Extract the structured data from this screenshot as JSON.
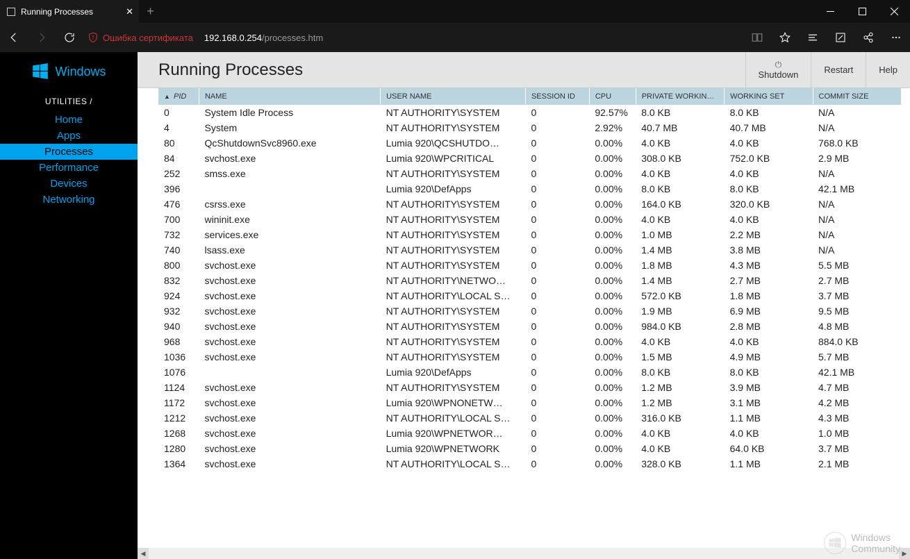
{
  "browser": {
    "tab_title": "Running Processes",
    "cert_error": "Ошибка сертификата",
    "url_host": "192.168.0.254",
    "url_path": "/processes.htm"
  },
  "sidebar": {
    "brand": "Windows",
    "section": "UTILITIES /",
    "items": [
      "Home",
      "Apps",
      "Processes",
      "Performance",
      "Devices",
      "Networking"
    ],
    "active_index": 2
  },
  "header": {
    "title": "Running Processes",
    "btn_shutdown": "Shutdown",
    "btn_restart": "Restart",
    "btn_help": "Help"
  },
  "table": {
    "columns": [
      "PID",
      "NAME",
      "USER NAME",
      "SESSION ID",
      "CPU",
      "PRIVATE WORKIN…",
      "WORKING SET",
      "COMMIT SIZE"
    ],
    "rows": [
      {
        "pid": "0",
        "name": "System Idle Process",
        "user": "NT AUTHORITY\\SYSTEM",
        "sess": "0",
        "cpu": "92.57%",
        "priv": "8.0 KB",
        "ws": "8.0 KB",
        "commit": "N/A"
      },
      {
        "pid": "4",
        "name": "System",
        "user": "NT AUTHORITY\\SYSTEM",
        "sess": "0",
        "cpu": "2.92%",
        "priv": "40.7 MB",
        "ws": "40.7 MB",
        "commit": "N/A"
      },
      {
        "pid": "80",
        "name": "QcShutdownSvc8960.exe",
        "user": "Lumia 920\\QCSHUTDO…",
        "sess": "0",
        "cpu": "0.00%",
        "priv": "4.0 KB",
        "ws": "4.0 KB",
        "commit": "768.0 KB"
      },
      {
        "pid": "84",
        "name": "svchost.exe",
        "user": "Lumia 920\\WPCRITICAL",
        "sess": "0",
        "cpu": "0.00%",
        "priv": "308.0 KB",
        "ws": "752.0 KB",
        "commit": "2.9 MB"
      },
      {
        "pid": "252",
        "name": "smss.exe",
        "user": "NT AUTHORITY\\SYSTEM",
        "sess": "0",
        "cpu": "0.00%",
        "priv": "4.0 KB",
        "ws": "4.0 KB",
        "commit": "N/A"
      },
      {
        "pid": "396",
        "name": "",
        "user": "Lumia 920\\DefApps",
        "sess": "0",
        "cpu": "0.00%",
        "priv": "8.0 KB",
        "ws": "8.0 KB",
        "commit": "42.1 MB"
      },
      {
        "pid": "476",
        "name": "csrss.exe",
        "user": "NT AUTHORITY\\SYSTEM",
        "sess": "0",
        "cpu": "0.00%",
        "priv": "164.0 KB",
        "ws": "320.0 KB",
        "commit": "N/A"
      },
      {
        "pid": "700",
        "name": "wininit.exe",
        "user": "NT AUTHORITY\\SYSTEM",
        "sess": "0",
        "cpu": "0.00%",
        "priv": "4.0 KB",
        "ws": "4.0 KB",
        "commit": "N/A"
      },
      {
        "pid": "732",
        "name": "services.exe",
        "user": "NT AUTHORITY\\SYSTEM",
        "sess": "0",
        "cpu": "0.00%",
        "priv": "1.0 MB",
        "ws": "2.2 MB",
        "commit": "N/A"
      },
      {
        "pid": "740",
        "name": "lsass.exe",
        "user": "NT AUTHORITY\\SYSTEM",
        "sess": "0",
        "cpu": "0.00%",
        "priv": "1.4 MB",
        "ws": "3.8 MB",
        "commit": "N/A"
      },
      {
        "pid": "800",
        "name": "svchost.exe",
        "user": "NT AUTHORITY\\SYSTEM",
        "sess": "0",
        "cpu": "0.00%",
        "priv": "1.8 MB",
        "ws": "4.3 MB",
        "commit": "5.5 MB"
      },
      {
        "pid": "832",
        "name": "svchost.exe",
        "user": "NT AUTHORITY\\NETWO…",
        "sess": "0",
        "cpu": "0.00%",
        "priv": "1.4 MB",
        "ws": "2.7 MB",
        "commit": "2.7 MB"
      },
      {
        "pid": "924",
        "name": "svchost.exe",
        "user": "NT AUTHORITY\\LOCAL S…",
        "sess": "0",
        "cpu": "0.00%",
        "priv": "572.0 KB",
        "ws": "1.8 MB",
        "commit": "3.7 MB"
      },
      {
        "pid": "932",
        "name": "svchost.exe",
        "user": "NT AUTHORITY\\SYSTEM",
        "sess": "0",
        "cpu": "0.00%",
        "priv": "1.9 MB",
        "ws": "6.9 MB",
        "commit": "9.5 MB"
      },
      {
        "pid": "940",
        "name": "svchost.exe",
        "user": "NT AUTHORITY\\SYSTEM",
        "sess": "0",
        "cpu": "0.00%",
        "priv": "984.0 KB",
        "ws": "2.8 MB",
        "commit": "4.8 MB"
      },
      {
        "pid": "968",
        "name": "svchost.exe",
        "user": "NT AUTHORITY\\SYSTEM",
        "sess": "0",
        "cpu": "0.00%",
        "priv": "4.0 KB",
        "ws": "4.0 KB",
        "commit": "884.0 KB"
      },
      {
        "pid": "1036",
        "name": "svchost.exe",
        "user": "NT AUTHORITY\\SYSTEM",
        "sess": "0",
        "cpu": "0.00%",
        "priv": "1.5 MB",
        "ws": "4.9 MB",
        "commit": "5.7 MB"
      },
      {
        "pid": "1076",
        "name": "",
        "user": "Lumia 920\\DefApps",
        "sess": "0",
        "cpu": "0.00%",
        "priv": "8.0 KB",
        "ws": "8.0 KB",
        "commit": "42.1 MB"
      },
      {
        "pid": "1124",
        "name": "svchost.exe",
        "user": "NT AUTHORITY\\SYSTEM",
        "sess": "0",
        "cpu": "0.00%",
        "priv": "1.2 MB",
        "ws": "3.9 MB",
        "commit": "4.7 MB"
      },
      {
        "pid": "1172",
        "name": "svchost.exe",
        "user": "Lumia 920\\WPNONETW…",
        "sess": "0",
        "cpu": "0.00%",
        "priv": "1.2 MB",
        "ws": "3.1 MB",
        "commit": "4.2 MB"
      },
      {
        "pid": "1212",
        "name": "svchost.exe",
        "user": "NT AUTHORITY\\LOCAL S…",
        "sess": "0",
        "cpu": "0.00%",
        "priv": "316.0 KB",
        "ws": "1.1 MB",
        "commit": "4.3 MB"
      },
      {
        "pid": "1268",
        "name": "svchost.exe",
        "user": "Lumia 920\\WPNETWOR…",
        "sess": "0",
        "cpu": "0.00%",
        "priv": "4.0 KB",
        "ws": "4.0 KB",
        "commit": "1.0 MB"
      },
      {
        "pid": "1280",
        "name": "svchost.exe",
        "user": "Lumia 920\\WPNETWORK",
        "sess": "0",
        "cpu": "0.00%",
        "priv": "4.0 KB",
        "ws": "64.0 KB",
        "commit": "3.7 MB"
      },
      {
        "pid": "1364",
        "name": "svchost.exe",
        "user": "NT AUTHORITY\\LOCAL S…",
        "sess": "0",
        "cpu": "0.00%",
        "priv": "328.0 KB",
        "ws": "1.1 MB",
        "commit": "2.1 MB"
      }
    ]
  },
  "watermark": {
    "line1": "Windows",
    "line2": "Community"
  }
}
